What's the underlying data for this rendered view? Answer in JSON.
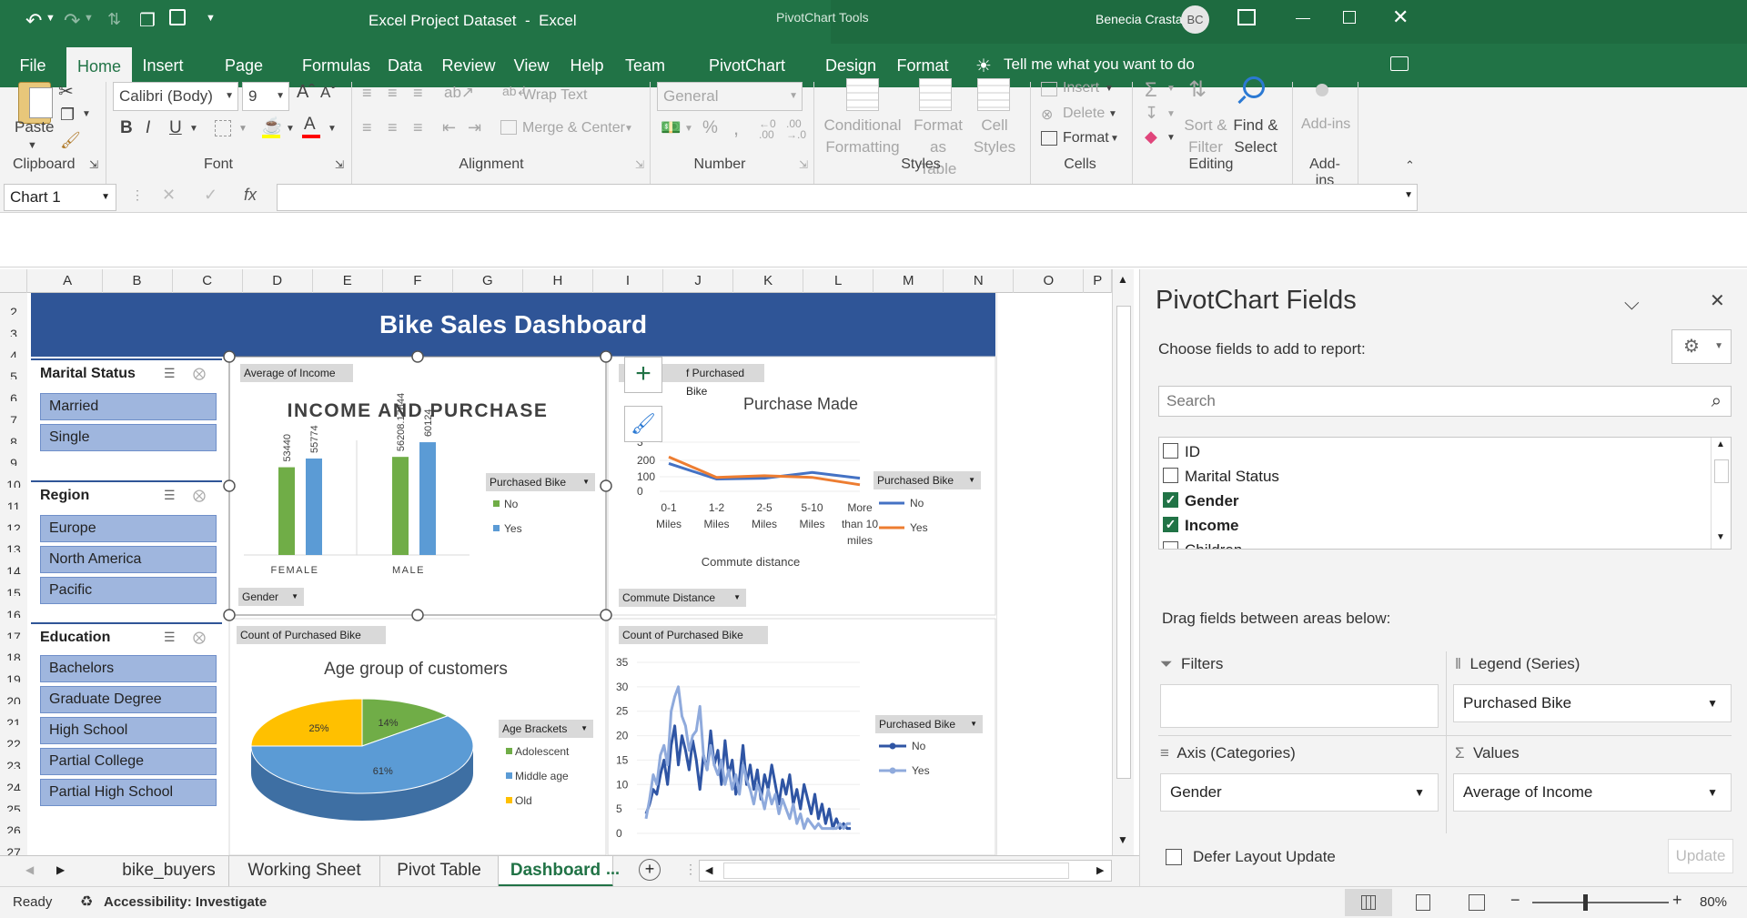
{
  "titlebar": {
    "title": "Excel Project Dataset  -  Excel",
    "context_tools": "PivotChart Tools",
    "user_name": "Benecia Crasta",
    "user_initials": "BC"
  },
  "tabs": [
    "File",
    "Home",
    "Insert",
    "Page Layout",
    "Formulas",
    "Data",
    "Review",
    "View",
    "Help",
    "Team",
    "PivotChart Analyze",
    "Design",
    "Format"
  ],
  "tell_me": "Tell me what you want to do",
  "ribbon": {
    "paste": "Paste",
    "font_name": "Calibri (Body)",
    "font_size": "9",
    "wrap_text": "Wrap Text",
    "merge_center": "Merge & Center",
    "number_format": "General",
    "conditional": [
      "Conditional",
      "Formatting"
    ],
    "format_as": [
      "Format as",
      "Table"
    ],
    "cell_styles": [
      "Cell",
      "Styles"
    ],
    "insert": "Insert",
    "delete": "Delete",
    "format": "Format",
    "sort": [
      "Sort &",
      "Filter"
    ],
    "find": [
      "Find &",
      "Select"
    ],
    "addins": "Add-ins",
    "groups": [
      "Clipboard",
      "Font",
      "Alignment",
      "Number",
      "Styles",
      "Cells",
      "Editing",
      "Add-ins"
    ]
  },
  "formula_bar": {
    "name_box": "Chart 1",
    "fx": "fx",
    "value": ""
  },
  "columns": [
    "A",
    "B",
    "C",
    "D",
    "E",
    "F",
    "G",
    "H",
    "I",
    "J",
    "K",
    "L",
    "M",
    "N",
    "O",
    "P"
  ],
  "rows": [
    "2",
    "3",
    "4",
    "5",
    "6",
    "7",
    "8",
    "9",
    "10",
    "11",
    "12",
    "13",
    "14",
    "15",
    "16",
    "17",
    "18",
    "19",
    "20",
    "21",
    "22",
    "23",
    "24",
    "25",
    "26",
    "27"
  ],
  "dashboard_title": "Bike Sales Dashboard",
  "slicers": [
    {
      "title": "Marital Status",
      "items": [
        "Married",
        "Single"
      ]
    },
    {
      "title": "Region",
      "items": [
        "Europe",
        "North America",
        "Pacific"
      ]
    },
    {
      "title": "Education",
      "items": [
        "Bachelors",
        "Graduate Degree",
        "High School",
        "Partial College",
        "Partial High School"
      ]
    }
  ],
  "charts": {
    "income": {
      "chip_value": "Average of Income",
      "chip_axis": "Gender",
      "chip_legend": "Purchased Bike",
      "legend": [
        "No",
        "Yes"
      ]
    },
    "commute": {
      "chip_value": "f Purchased Bike",
      "chip_axis": "Commute Distance",
      "chip_legend": "Purchased Bike",
      "legend": [
        "No",
        "Yes"
      ]
    },
    "age": {
      "chip_value": "Count of Purchased Bike",
      "chip_legend": "Age Brackets",
      "legend": [
        "Adolescent",
        "Middle age",
        "Old"
      ]
    },
    "count": {
      "chip_value": "Count of Purchased Bike",
      "chip_legend": "Purchased Bike",
      "legend": [
        "No",
        "Yes"
      ]
    }
  },
  "chart_data": [
    {
      "type": "bar",
      "title": "INCOME AND PURCHASE",
      "categories": [
        "FEMALE",
        "MALE"
      ],
      "series": [
        {
          "name": "No",
          "values": [
            53440,
            56208.17844
          ]
        },
        {
          "name": "Yes",
          "values": [
            55774,
            60124
          ]
        }
      ],
      "data_labels": [
        "53440",
        "55774",
        "56208.17844",
        "60124"
      ],
      "colors": {
        "No": "#70ad47",
        "Yes": "#5b9bd5"
      },
      "legend": "right"
    },
    {
      "type": "line",
      "title": "Purchase Made",
      "xlabel": "Commute distance",
      "categories": [
        "0-1 Miles",
        "1-2 Miles",
        "2-5 Miles",
        "5-10 Miles",
        "More than 10 miles"
      ],
      "series": [
        {
          "name": "No",
          "values": [
            170,
            75,
            80,
            115,
            80
          ]
        },
        {
          "name": "Yes",
          "values": [
            210,
            85,
            95,
            85,
            40
          ]
        }
      ],
      "ylim": [
        0,
        300
      ],
      "yticks": [
        "0",
        "100",
        "200",
        "3"
      ],
      "colors": {
        "No": "#4472c4",
        "Yes": "#ed7d31"
      },
      "legend": "right"
    },
    {
      "type": "pie",
      "title": "Age group of customers",
      "categories": [
        "Adolescent",
        "Middle age",
        "Old"
      ],
      "values": [
        14,
        61,
        25
      ],
      "data_labels": [
        "14%",
        "61%",
        "25%"
      ],
      "colors": {
        "Adolescent": "#70ad47",
        "Middle age": "#5b9bd5",
        "Old": "#ffc000"
      },
      "legend": "right"
    },
    {
      "type": "line",
      "yticks": [
        "0",
        "5",
        "10",
        "15",
        "20",
        "25",
        "30",
        "35"
      ],
      "ylim": [
        0,
        35
      ],
      "series": [
        {
          "name": "No",
          "values": [
            4,
            6,
            9,
            8,
            12,
            15,
            10,
            18,
            22,
            14,
            20,
            17,
            13,
            19,
            15,
            9,
            16,
            13,
            21,
            14,
            17,
            10,
            19,
            12,
            15,
            8,
            11,
            18,
            10,
            14,
            9,
            13,
            7,
            12,
            9,
            14,
            10,
            6,
            11,
            8,
            12,
            6,
            9,
            5,
            10,
            7,
            4,
            8,
            3,
            6,
            2,
            5,
            1,
            3,
            1,
            2,
            1,
            1
          ]
        },
        {
          "name": "Yes",
          "values": [
            3,
            7,
            12,
            10,
            16,
            18,
            14,
            25,
            28,
            30,
            24,
            22,
            17,
            20,
            21,
            26,
            16,
            13,
            18,
            14,
            12,
            15,
            10,
            13,
            9,
            12,
            8,
            14,
            11,
            9,
            6,
            10,
            8,
            5,
            9,
            6,
            8,
            4,
            7,
            5,
            3,
            6,
            2,
            4,
            1,
            3,
            2,
            1,
            2,
            1,
            1,
            1,
            1,
            1,
            2,
            1,
            2,
            2
          ]
        }
      ],
      "colors": {
        "No": "#2f55a4",
        "Yes": "#8faadc"
      },
      "legend": "right"
    }
  ],
  "pane": {
    "title": "PivotChart Fields",
    "choose": "Choose fields to add to report:",
    "search_placeholder": "Search",
    "fields": [
      {
        "name": "ID",
        "checked": false
      },
      {
        "name": "Marital Status",
        "checked": false
      },
      {
        "name": "Gender",
        "checked": true
      },
      {
        "name": "Income",
        "checked": true
      },
      {
        "name": "Children",
        "checked": false
      }
    ],
    "drag_text": "Drag fields between areas below:",
    "filters": "Filters",
    "legend_series": "Legend (Series)",
    "legend_value": "Purchased Bike",
    "axis": "Axis (Categories)",
    "axis_value": "Gender",
    "values": "Values",
    "values_value": "Average of Income",
    "defer": "Defer Layout Update",
    "update": "Update"
  },
  "sheet_tabs": [
    "bike_buyers",
    "Working Sheet",
    "Pivot Table",
    "Dashboard"
  ],
  "sheet_tabs_more": "...",
  "status": {
    "ready": "Ready",
    "accessibility": "Accessibility: Investigate",
    "zoom": "80%"
  }
}
